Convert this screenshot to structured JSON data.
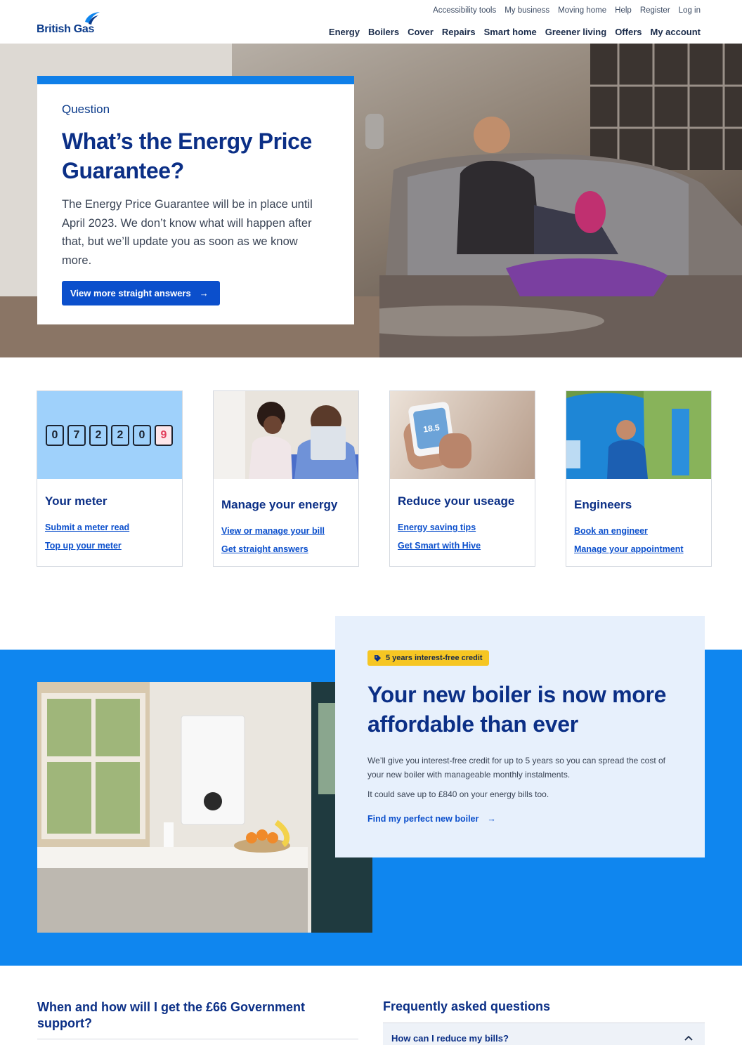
{
  "brand": {
    "name": "British Gas",
    "color": "#0b2f86",
    "accent": "#0f86ef"
  },
  "utility_nav": [
    "Accessibility tools",
    "My business",
    "Moving home",
    "Help",
    "Register",
    "Log in"
  ],
  "main_nav": [
    "Energy",
    "Boilers",
    "Cover",
    "Repairs",
    "Smart home",
    "Greener living",
    "Offers",
    "My account"
  ],
  "hero": {
    "kicker": "Question",
    "title": "What’s the Energy Price Guarantee?",
    "body": "The Energy Price Guarantee will be in place until April 2023. We don’t know what will happen after that, but we’ll update you as soon as we know more.",
    "button": "View more straight answers"
  },
  "tiles": [
    {
      "title": "Your meter",
      "links": [
        "Submit a meter read",
        "Top up your meter"
      ],
      "meter_digits": [
        "0",
        "7",
        "2",
        "2",
        "0",
        "9"
      ]
    },
    {
      "title": "Manage your energy",
      "links": [
        "View or manage your bill",
        "Get straight answers"
      ]
    },
    {
      "title": "Reduce your useage",
      "links": [
        "Energy saving tips",
        "Get Smart with Hive"
      ],
      "thermostat": "18.5"
    },
    {
      "title": "Engineers",
      "links": [
        "Book an engineer",
        "Manage your appointment"
      ]
    }
  ],
  "boiler": {
    "badge": "5 years interest-free credit",
    "title": "Your new boiler is now more affordable than ever",
    "p1": "We’ll give you interest-free credit for up to 5 years so you can spread the cost of your new boiler with manageable monthly instalments.",
    "p2": "It could save up to £840 on your energy bills too.",
    "link": "Find my perfect new boiler"
  },
  "gov": {
    "title": "When and how will I get the £66 Government support?"
  },
  "faq": {
    "title": "Frequently asked questions",
    "items": [
      "How can I reduce my bills?"
    ]
  }
}
